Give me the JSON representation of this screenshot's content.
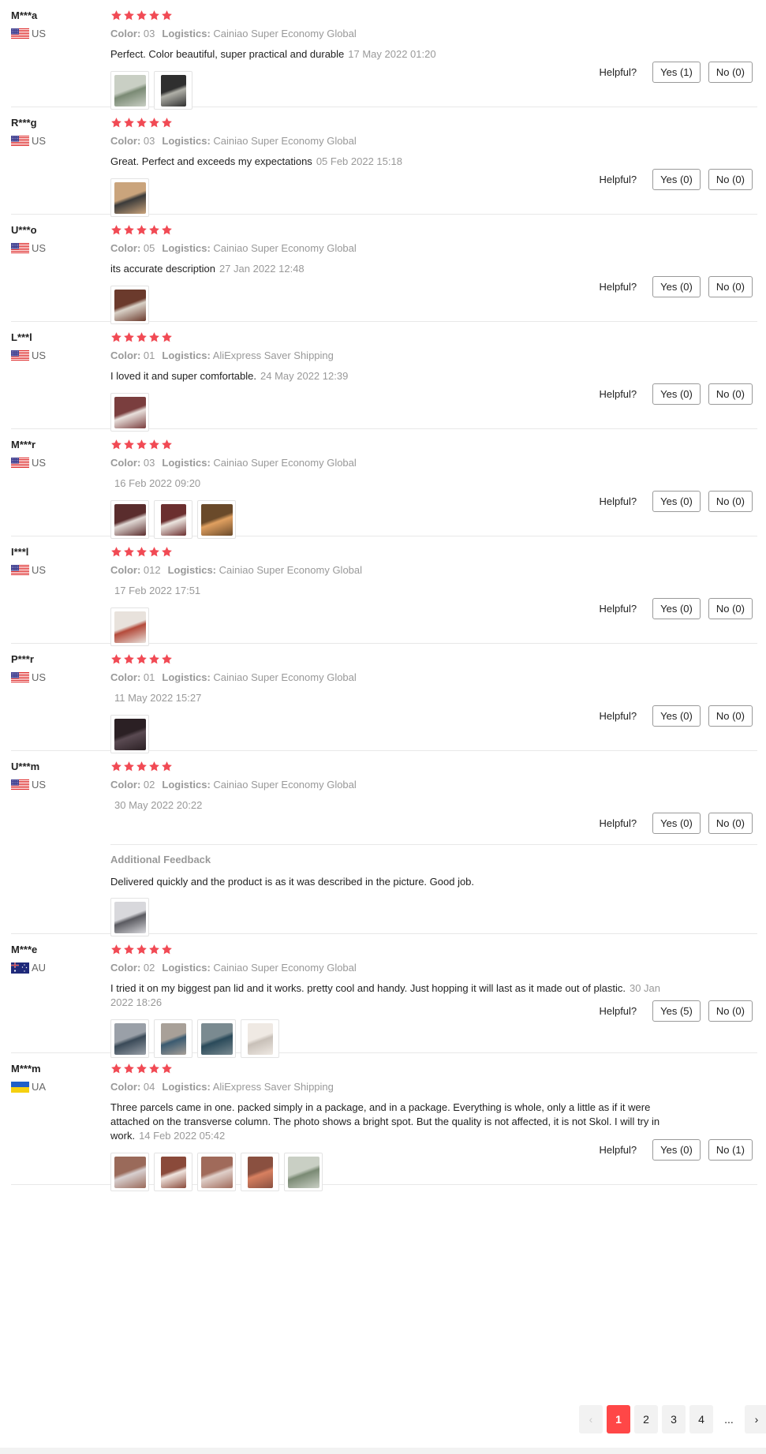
{
  "labels": {
    "color": "Color:",
    "logistics": "Logistics:",
    "helpful": "Helpful?",
    "additional_feedback": "Additional Feedback"
  },
  "colors": {
    "star": "#f14a54",
    "accent": "#ff4747"
  },
  "reviews": [
    {
      "name": "M***a",
      "country": "US",
      "flag": "us",
      "rating": 5,
      "color": "03",
      "logistics": "Cainiao Super Economy Global",
      "text": "Perfect. Color beautiful, super practical and durable",
      "date": "17 May 2022 01:20",
      "photos": 2,
      "yes": "Yes (1)",
      "no": "No (0)"
    },
    {
      "name": "R***g",
      "country": "US",
      "flag": "us",
      "rating": 5,
      "color": "03",
      "logistics": "Cainiao Super Economy Global",
      "text": "Great. Perfect and exceeds my expectations",
      "date": "05 Feb 2022 15:18",
      "photos": 1,
      "yes": "Yes (0)",
      "no": "No (0)"
    },
    {
      "name": "U***o",
      "country": "US",
      "flag": "us",
      "rating": 5,
      "color": "05",
      "logistics": "Cainiao Super Economy Global",
      "text": "its accurate description",
      "date": "27 Jan 2022 12:48",
      "photos": 1,
      "yes": "Yes (0)",
      "no": "No (0)"
    },
    {
      "name": "L***l",
      "country": "US",
      "flag": "us",
      "rating": 5,
      "color": "01",
      "logistics": "AliExpress Saver Shipping",
      "text": "I loved it and super comfortable.",
      "date": "24 May 2022 12:39",
      "photos": 1,
      "yes": "Yes (0)",
      "no": "No (0)"
    },
    {
      "name": "M***r",
      "country": "US",
      "flag": "us",
      "rating": 5,
      "color": "03",
      "logistics": "Cainiao Super Economy Global",
      "text": "",
      "date": "16 Feb 2022 09:20",
      "photos": 3,
      "yes": "Yes (0)",
      "no": "No (0)"
    },
    {
      "name": "I***l",
      "country": "US",
      "flag": "us",
      "rating": 5,
      "color": "012",
      "logistics": "Cainiao Super Economy Global",
      "text": "",
      "date": "17 Feb 2022 17:51",
      "photos": 1,
      "yes": "Yes (0)",
      "no": "No (0)"
    },
    {
      "name": "P***r",
      "country": "US",
      "flag": "us",
      "rating": 5,
      "color": "01",
      "logistics": "Cainiao Super Economy Global",
      "text": "",
      "date": "11 May 2022 15:27",
      "photos": 1,
      "yes": "Yes (0)",
      "no": "No (0)"
    },
    {
      "name": "U***m",
      "country": "US",
      "flag": "us",
      "rating": 5,
      "color": "02",
      "logistics": "Cainiao Super Economy Global",
      "text": "",
      "date": "30 May 2022 20:22",
      "photos": 0,
      "yes": "Yes (0)",
      "no": "No (0)",
      "additional": {
        "text": "Delivered quickly and the product is as it was described in the picture. Good job.",
        "photos": 1
      }
    },
    {
      "name": "M***e",
      "country": "AU",
      "flag": "au",
      "rating": 5,
      "color": "02",
      "logistics": "Cainiao Super Economy Global",
      "text": "I tried it on my biggest pan lid and it works. pretty cool and handy. Just hopping it will last as it made out of plastic.",
      "date": "30 Jan 2022 18:26",
      "photos": 4,
      "yes": "Yes (5)",
      "no": "No (0)"
    },
    {
      "name": "M***m",
      "country": "UA",
      "flag": "ua",
      "rating": 5,
      "color": "04",
      "logistics": "AliExpress Saver Shipping",
      "text": "Three parcels came in one. packed simply in a package, and in a package. Everything is whole, only a little as if it were attached on the transverse column. The photo shows a bright spot. But the quality is not affected, it is not Skol. I will try in work.",
      "date": "14 Feb 2022 05:42",
      "photos": 5,
      "yes": "Yes (0)",
      "no": "No (1)"
    }
  ],
  "pagination": {
    "prev_icon": "chevron-left-icon",
    "pages": [
      "1",
      "2",
      "3",
      "4"
    ],
    "current": "1",
    "ellipsis": "...",
    "next_icon": "chevron-right-icon"
  }
}
